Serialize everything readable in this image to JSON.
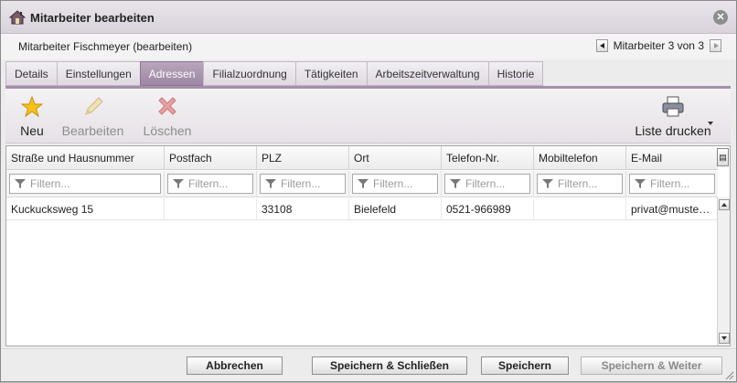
{
  "window": {
    "title": "Mitarbeiter bearbeiten"
  },
  "subheader": {
    "employee": "Mitarbeiter Fischmeyer (bearbeiten)",
    "record_nav": "Mitarbeiter 3 von 3"
  },
  "tabs": [
    {
      "label": "Details"
    },
    {
      "label": "Einstellungen"
    },
    {
      "label": "Adressen",
      "active": true
    },
    {
      "label": "Filialzuordnung"
    },
    {
      "label": "Tätigkeiten"
    },
    {
      "label": "Arbeitszeitverwaltung"
    },
    {
      "label": "Historie"
    }
  ],
  "toolbar": {
    "new_label": "Neu",
    "edit_label": "Bearbeiten",
    "delete_label": "Löschen",
    "print_label": "Liste drucken"
  },
  "grid": {
    "columns": [
      "Straße und Hausnummer",
      "Postfach",
      "PLZ",
      "Ort",
      "Telefon-Nr.",
      "Mobiltelefon",
      "E-Mail"
    ],
    "filter_placeholder": "Filtern...",
    "rows": [
      [
        "Kuckucksweg 15",
        "",
        "33108",
        "Bielefeld",
        "0521-966989",
        "",
        "privat@muste…"
      ]
    ]
  },
  "footer": {
    "cancel_label": "Abbrechen",
    "save_close_label": "Speichern & Schließen",
    "save_label": "Speichern",
    "save_next_label": "Speichern & Weiter"
  },
  "colors": {
    "accent_tab": "#a48fa9",
    "titlebar": "#d9d2dc"
  }
}
